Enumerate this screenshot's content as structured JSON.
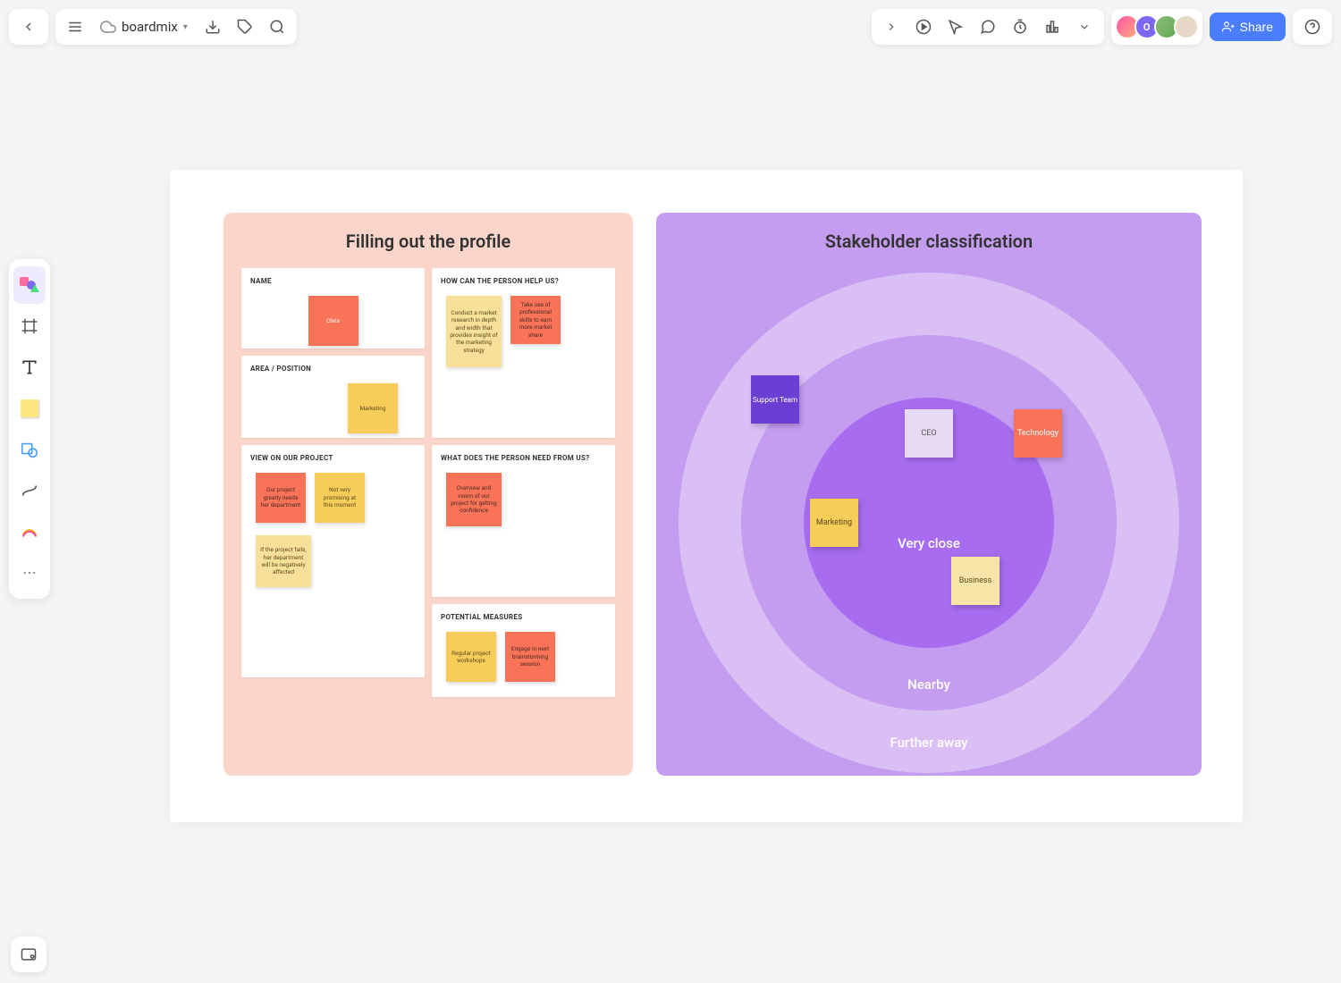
{
  "header": {
    "brand": "boardmix",
    "share_label": "Share"
  },
  "profile": {
    "title": "Filling out the profile",
    "name": {
      "label": "NAME",
      "notes": [
        "Chris"
      ]
    },
    "area": {
      "label": "AREA / POSITION",
      "notes": [
        "Marketing"
      ]
    },
    "help": {
      "label": "HOW CAN THE PERSON HELP US?",
      "notes": [
        "Conduct a market research in depth and width that provides insight of the marketing strategy",
        "Take use of professional skills to earn more market share"
      ]
    },
    "view": {
      "label": "VIEW ON OUR PROJECT",
      "notes": [
        "Our project greatly needs her department",
        "Not very promising at this moment",
        "If the project fails, her department will be negatively affected"
      ]
    },
    "need": {
      "label": "WHAT DOES THE PERSON NEED FROM US?",
      "notes": [
        "Overview and vision of our project for getting confidence"
      ]
    },
    "measures": {
      "label": "POTENTIAL MEASURES",
      "notes": [
        "Regular project workshops",
        "Engage in next brainstorming session"
      ]
    }
  },
  "stakeholder": {
    "title": "Stakeholder classification",
    "rings": {
      "inner": "Very close",
      "mid": "Nearby",
      "outer": "Further away"
    },
    "notes": {
      "ceo": "CEO",
      "support": "Support Team",
      "tech": "Technology",
      "marketing": "Marketing",
      "business": "Business"
    }
  },
  "avatars": {
    "initial": "O"
  }
}
